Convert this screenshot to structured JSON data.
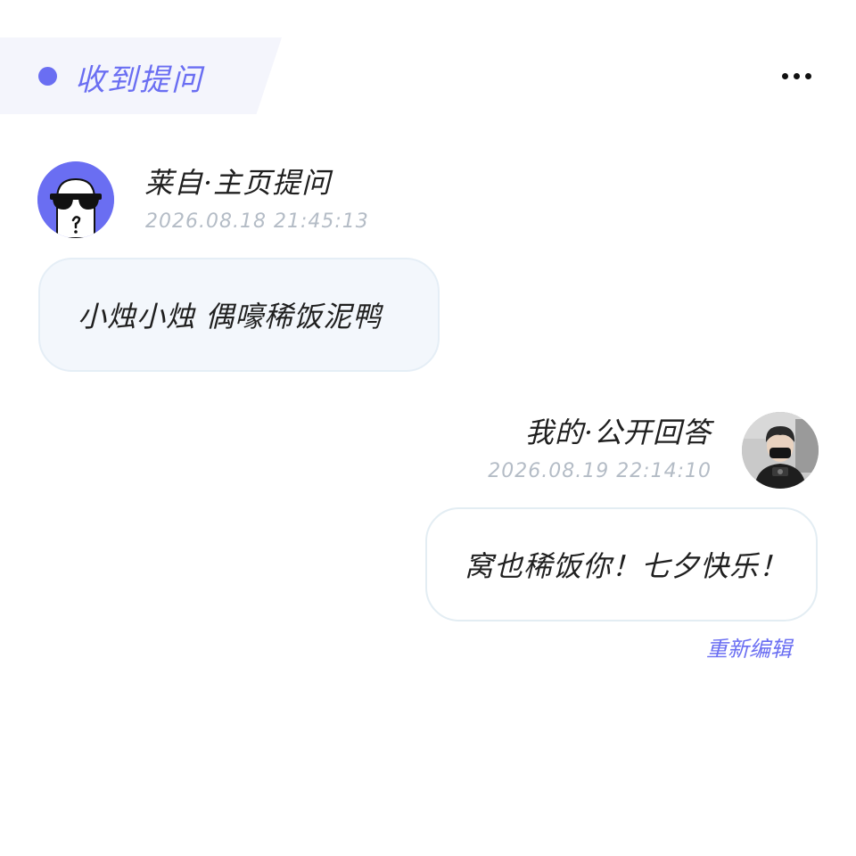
{
  "header": {
    "title": "收到提问",
    "accent_color": "#6a6ef2",
    "more_icon": "ellipsis-icon"
  },
  "question": {
    "sender_label": "莱自·主页提问",
    "timestamp": "2026.08.18 21:45:13",
    "text": "小烛小烛 偶嚎稀饭泥鸭",
    "avatar_icon": "sunglasses-ghost-avatar"
  },
  "answer": {
    "sender_label": "我的·公开回答",
    "timestamp": "2026.08.19 22:14:10",
    "text": "窝也稀饭你！七夕快乐！",
    "avatar_icon": "user-photo-avatar",
    "reedit_label": "重新编辑"
  }
}
